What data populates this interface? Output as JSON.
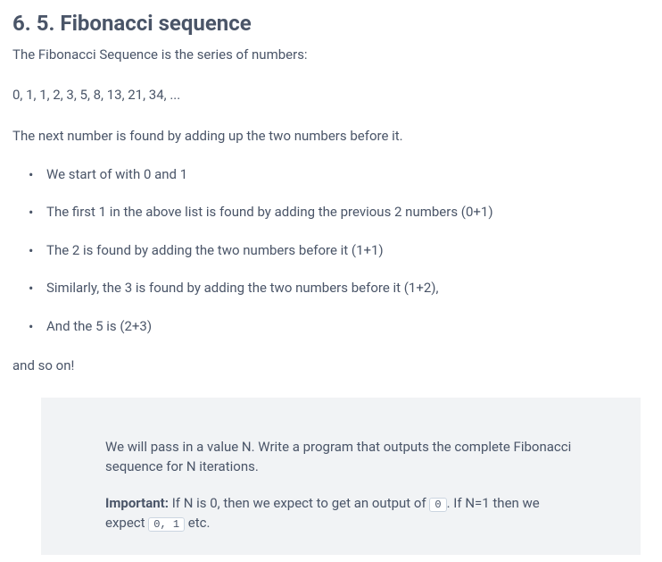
{
  "heading": "6. 5. Fibonacci sequence",
  "intro": "The Fibonacci Sequence is the series of numbers:",
  "sequence": "0, 1, 1, 2, 3, 5, 8, 13, 21, 34, ...",
  "explain": "The next number is found by adding up the two numbers before it.",
  "bullets": [
    "We start of with 0 and 1",
    "The first 1 in the above list is found by adding the previous 2 numbers (0+1)",
    "The 2 is found by adding the two numbers before it (1+1)",
    "Similarly, the 3 is found by adding the two numbers before it (1+2),",
    "And the 5 is (2+3)"
  ],
  "and_so_on": "and so on!",
  "callout": {
    "line1": "We will pass in a value N. Write a program that outputs the complete Fibonacci sequence for N iterations.",
    "important_label": "Important:",
    "part1": " If N is 0, then we expect to get an output of ",
    "code1": "0",
    "part2": ". If N=1 then we expect ",
    "code2": "0, 1",
    "part3": " etc."
  }
}
